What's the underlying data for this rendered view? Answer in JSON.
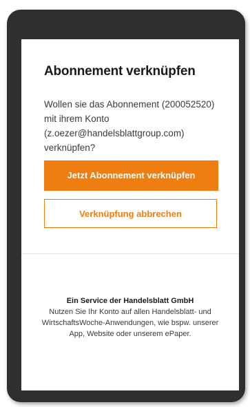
{
  "dialog": {
    "title": "Abonnement verknüpfen",
    "description": "Wollen sie das Abonnement (200052520) mit ihrem Konto (z.oezer@handelsblattgroup.com) verknüpfen?",
    "confirm_label": "Jetzt Abonnement verknüpfen",
    "cancel_label": "Verknüpfung abbrechen"
  },
  "footer": {
    "title": "Ein Service der Handelsblatt GmbH",
    "text": "Nutzen Sie Ihr Konto auf allen Handelsblatt- und WirtschaftsWoche-Anwendungen, wie bspw. unserer App, Website oder unserem ePaper."
  },
  "colors": {
    "accent": "#ef7d0f",
    "device_frame": "#2f2f2f"
  }
}
